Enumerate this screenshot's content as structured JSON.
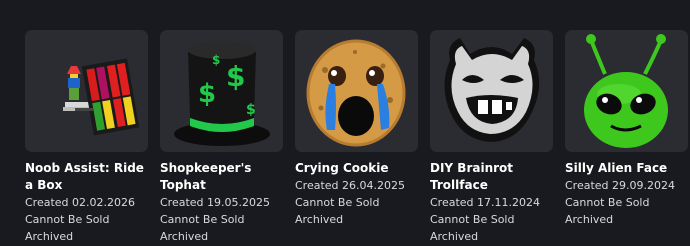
{
  "items": [
    {
      "name": "Noob Assist: Ride a Box",
      "created": "Created 02.02.2026",
      "sale_status": "Cannot Be Sold",
      "state": "Archived",
      "icon": "noob-box-icon"
    },
    {
      "name": "Shopkeeper's Tophat",
      "created": "Created 19.05.2025",
      "sale_status": "Cannot Be Sold",
      "state": "Archived",
      "icon": "tophat-icon"
    },
    {
      "name": "Crying Cookie",
      "created": "Created 26.04.2025",
      "sale_status": "Cannot Be Sold",
      "state": "Archived",
      "icon": "cookie-icon"
    },
    {
      "name": "DIY Brainrot Trollface",
      "created": "Created 17.11.2024",
      "sale_status": "Cannot Be Sold",
      "state": "Archived",
      "icon": "trollface-icon"
    },
    {
      "name": "Silly Alien Face",
      "created": "Created 29.09.2024",
      "sale_status": "Cannot Be Sold",
      "state": "Archived",
      "icon": "alien-face-icon"
    }
  ],
  "colors": {
    "background": "#191a1f",
    "card_thumb": "#2b2c32",
    "title": "#ffffff",
    "meta": "#d9dadc"
  }
}
